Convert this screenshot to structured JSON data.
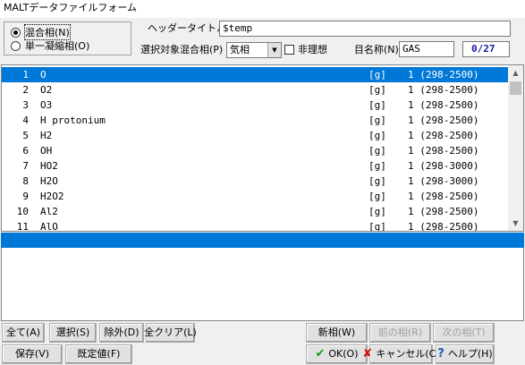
{
  "window": {
    "title": "MALTデータファイルフォーム"
  },
  "phase_mode": {
    "options": [
      {
        "label": "混合相(N)",
        "selected": true
      },
      {
        "label": "単一凝縮相(O)",
        "selected": false
      }
    ]
  },
  "header": {
    "header_title_label": "ヘッダータイトル",
    "header_title_value": "$temp",
    "target_phase_label": "選択対象混合相(P)",
    "target_phase_value": "気相",
    "nonideal_label": "非理想",
    "nonideal_checked": false,
    "name_label": "目名称(N)",
    "name_value": "GAS",
    "counter": "0/27"
  },
  "species": {
    "selected_index": 0,
    "rows": [
      {
        "num": "1",
        "name": "O",
        "phase": "[g]",
        "range": "1 (298-2500)"
      },
      {
        "num": "2",
        "name": "O2",
        "phase": "[g]",
        "range": "1 (298-2500)"
      },
      {
        "num": "3",
        "name": "O3",
        "phase": "[g]",
        "range": "1 (298-2500)"
      },
      {
        "num": "4",
        "name": "H protonium",
        "phase": "[g]",
        "range": "1 (298-2500)"
      },
      {
        "num": "5",
        "name": "H2",
        "phase": "[g]",
        "range": "1 (298-2500)"
      },
      {
        "num": "6",
        "name": "OH",
        "phase": "[g]",
        "range": "1 (298-2500)"
      },
      {
        "num": "7",
        "name": "HO2",
        "phase": "[g]",
        "range": "1 (298-3000)"
      },
      {
        "num": "8",
        "name": "H2O",
        "phase": "[g]",
        "range": "1 (298-3000)"
      },
      {
        "num": "9",
        "name": "H2O2",
        "phase": "[g]",
        "range": "1 (298-2500)"
      },
      {
        "num": "10",
        "name": "Al2",
        "phase": "[g]",
        "range": "1 (298-2500)"
      },
      {
        "num": "11",
        "name": "AlO",
        "phase": "[g]",
        "range": "1 (298-2500)"
      }
    ]
  },
  "buttons": {
    "all": "全て(A)",
    "select": "選択(S)",
    "exclude": "除外(D)",
    "clear_all": "全クリア(L)",
    "new_phase": "新相(W)",
    "prev_phase": "前の相(R)",
    "next_phase": "次の相(T)",
    "save": "保存(V)",
    "default": "既定値(F)",
    "ok": "OK(O)",
    "cancel": "キャンセル(C)",
    "help": "ヘルプ(H)"
  },
  "icons": {
    "ok": "check-icon",
    "cancel": "x-icon",
    "help": "question-icon"
  },
  "colors": {
    "selection": "#0078d7",
    "counter_text": "#1a1aa8"
  }
}
